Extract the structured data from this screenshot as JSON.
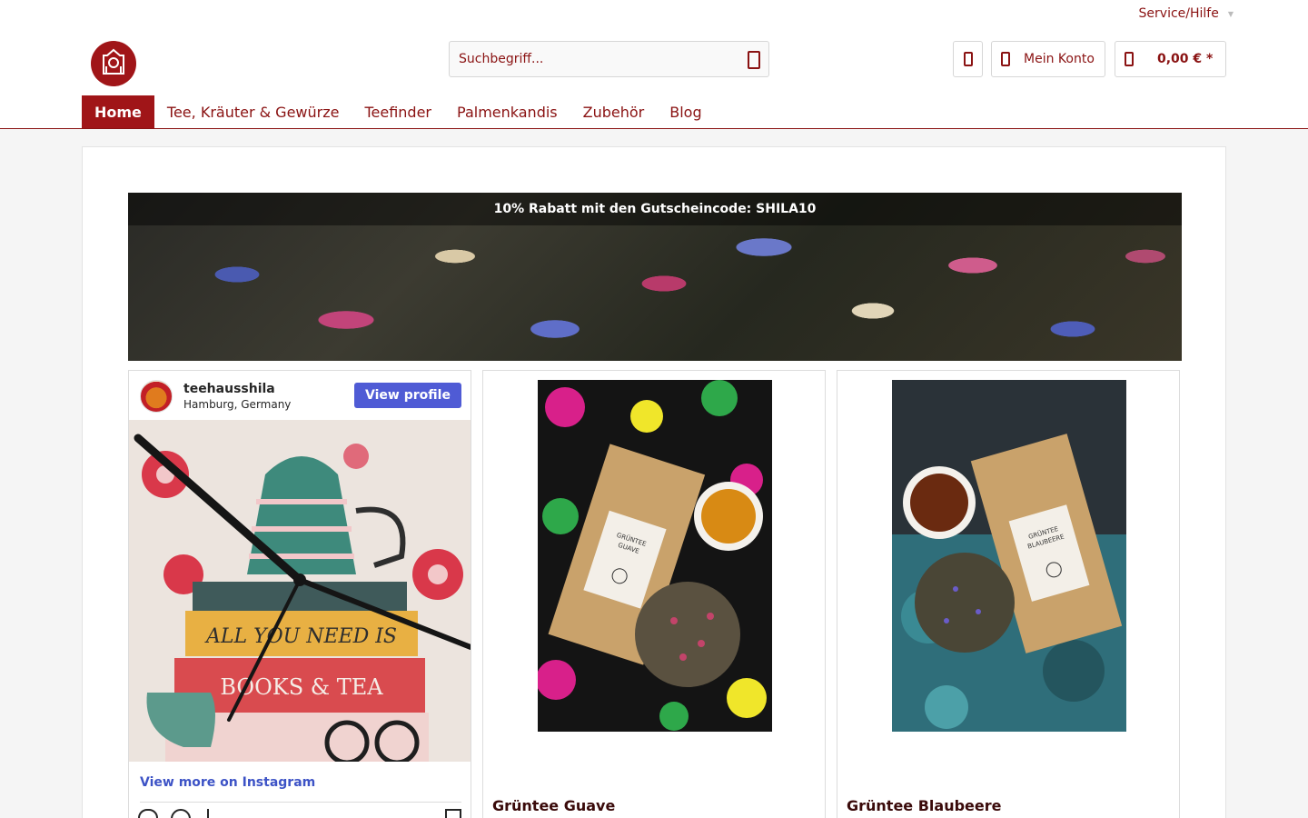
{
  "topbar": {
    "service_label": "Service/Hilfe"
  },
  "header": {
    "search": {
      "placeholder": "Suchbegriff..."
    },
    "account_label": "Mein Konto",
    "cart_total": "0,00 € *"
  },
  "nav": {
    "items": [
      {
        "label": "Home"
      },
      {
        "label": "Tee, Kräuter & Gewürze"
      },
      {
        "label": "Teefinder"
      },
      {
        "label": "Palmenkandis"
      },
      {
        "label": "Zubehör"
      },
      {
        "label": "Blog"
      }
    ]
  },
  "banner": {
    "promo": "10% Rabatt mit den Gutscheincode: SHILA10"
  },
  "instagram": {
    "username": "teehausshila",
    "location": "Hamburg, Germany",
    "view_profile": "View profile",
    "view_more": "View more on Instagram",
    "image_lettering": [
      "ALL YOU NEED IS",
      "BOOKS & TEA"
    ]
  },
  "products": [
    {
      "name": "Grüntee Guave",
      "package_label": "GRÜNTEE GUAVE"
    },
    {
      "name": "Grüntee Blaubeere",
      "package_label": "GRÜNTEE BLAUBEERE"
    }
  ],
  "colors": {
    "accent": "#a01518",
    "text": "#8a1212",
    "instagram_blue": "#4f5bd5"
  }
}
